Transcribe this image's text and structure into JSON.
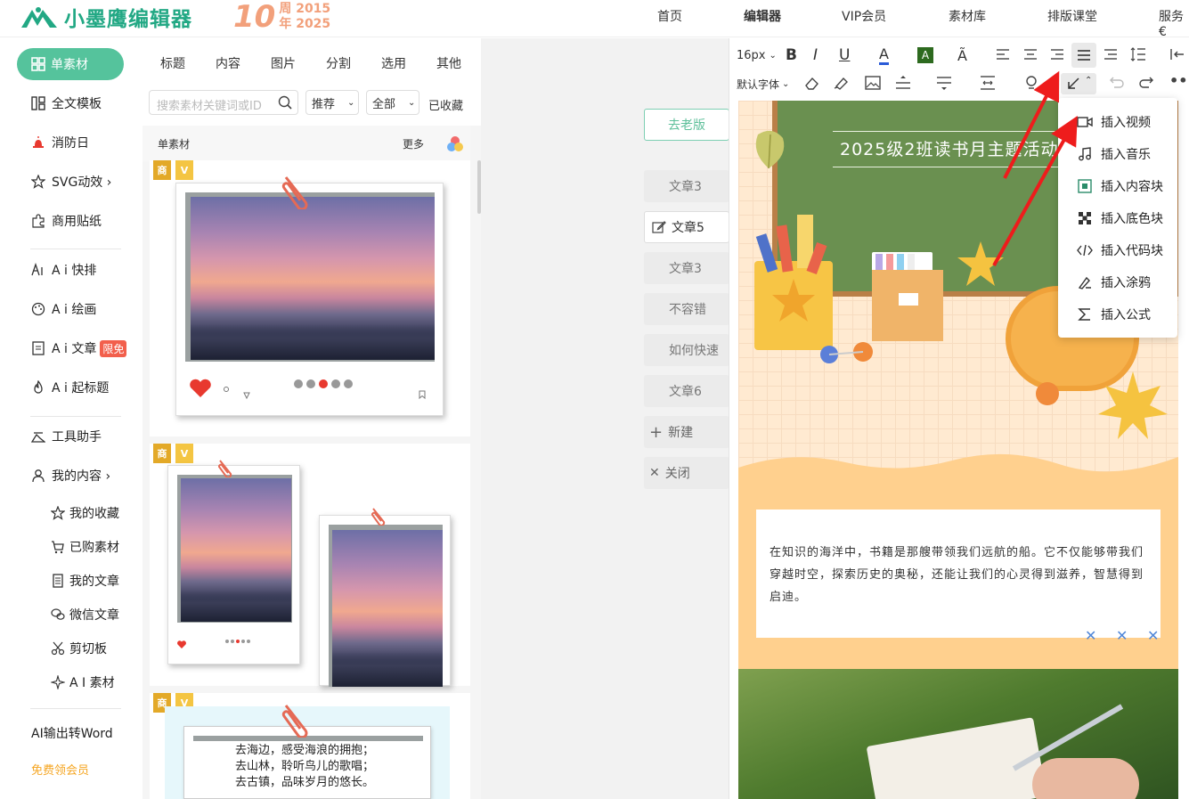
{
  "header": {
    "logo_text": "小墨鹰编辑器",
    "anniversary_number": "10",
    "anniversary_line1": "周 2015",
    "anniversary_line2": "年 2025",
    "nav": [
      "首页",
      "编辑器",
      "VIP会员",
      "素材库",
      "排版课堂",
      "服务€"
    ]
  },
  "sidebar": {
    "active_item": "单素材",
    "items": [
      "全文模板",
      "消防日",
      "SVG动效 ›",
      "商用贴纸",
      "A i 快排",
      "A i 绘画",
      "A i 文章",
      "A i 起标题",
      "工具助手",
      "我的内容 ›"
    ],
    "free_badge": "限免",
    "sub_items": [
      "我的收藏",
      "已购素材",
      "我的文章",
      "微信文章",
      "剪切板",
      "A I 素材"
    ],
    "bottom_link": "AI输出转Word",
    "vip_link": "免费领会员",
    "vip_color": "#f5a623",
    "active_color": "#55c39c"
  },
  "materials": {
    "tabs": [
      "标题",
      "内容",
      "图片",
      "分割",
      "选用",
      "其他"
    ],
    "search_placeholder": "搜索素材关键词或ID",
    "sort_select": "推荐",
    "scope_select": "全部",
    "favorites": "已收藏",
    "section_title": "单素材",
    "more": "更多",
    "tag_commercial": "商",
    "tag_vip": "V",
    "poem_lines": [
      "去海边，感受海浪的拥抱；",
      "去山林，聆听鸟儿的歌唱；",
      "去古镇，品味岁月的悠长。"
    ]
  },
  "documents": {
    "old_version": "去老版",
    "items": [
      "文章3",
      "文章5",
      "文章3",
      "不容错",
      "如何快速",
      "文章6"
    ],
    "active_index": 1,
    "new_label": "新建",
    "close_label": "关闭"
  },
  "editor": {
    "font_size": "16px",
    "font_family": "默认字体",
    "board_title": "2025级2班读书月主题活动",
    "paragraph": "在知识的海洋中，书籍是那艘带领我们远航的船。它不仅能够带我们穿越时空，探索历史的奥秘，还能让我们的心灵得到滋养，智慧得到启迪。",
    "deco_mark": "✕"
  },
  "insert_menu": {
    "items": [
      {
        "label": "插入视频",
        "icon": "video-icon"
      },
      {
        "label": "插入音乐",
        "icon": "music-icon"
      },
      {
        "label": "插入内容块",
        "icon": "content-block-icon"
      },
      {
        "label": "插入底色块",
        "icon": "background-block-icon"
      },
      {
        "label": "插入代码块",
        "icon": "code-icon"
      },
      {
        "label": "插入涂鸦",
        "icon": "doodle-icon"
      },
      {
        "label": "插入公式",
        "icon": "formula-icon"
      }
    ]
  },
  "annotation": {
    "arrow_color": "#ee1c1c"
  }
}
